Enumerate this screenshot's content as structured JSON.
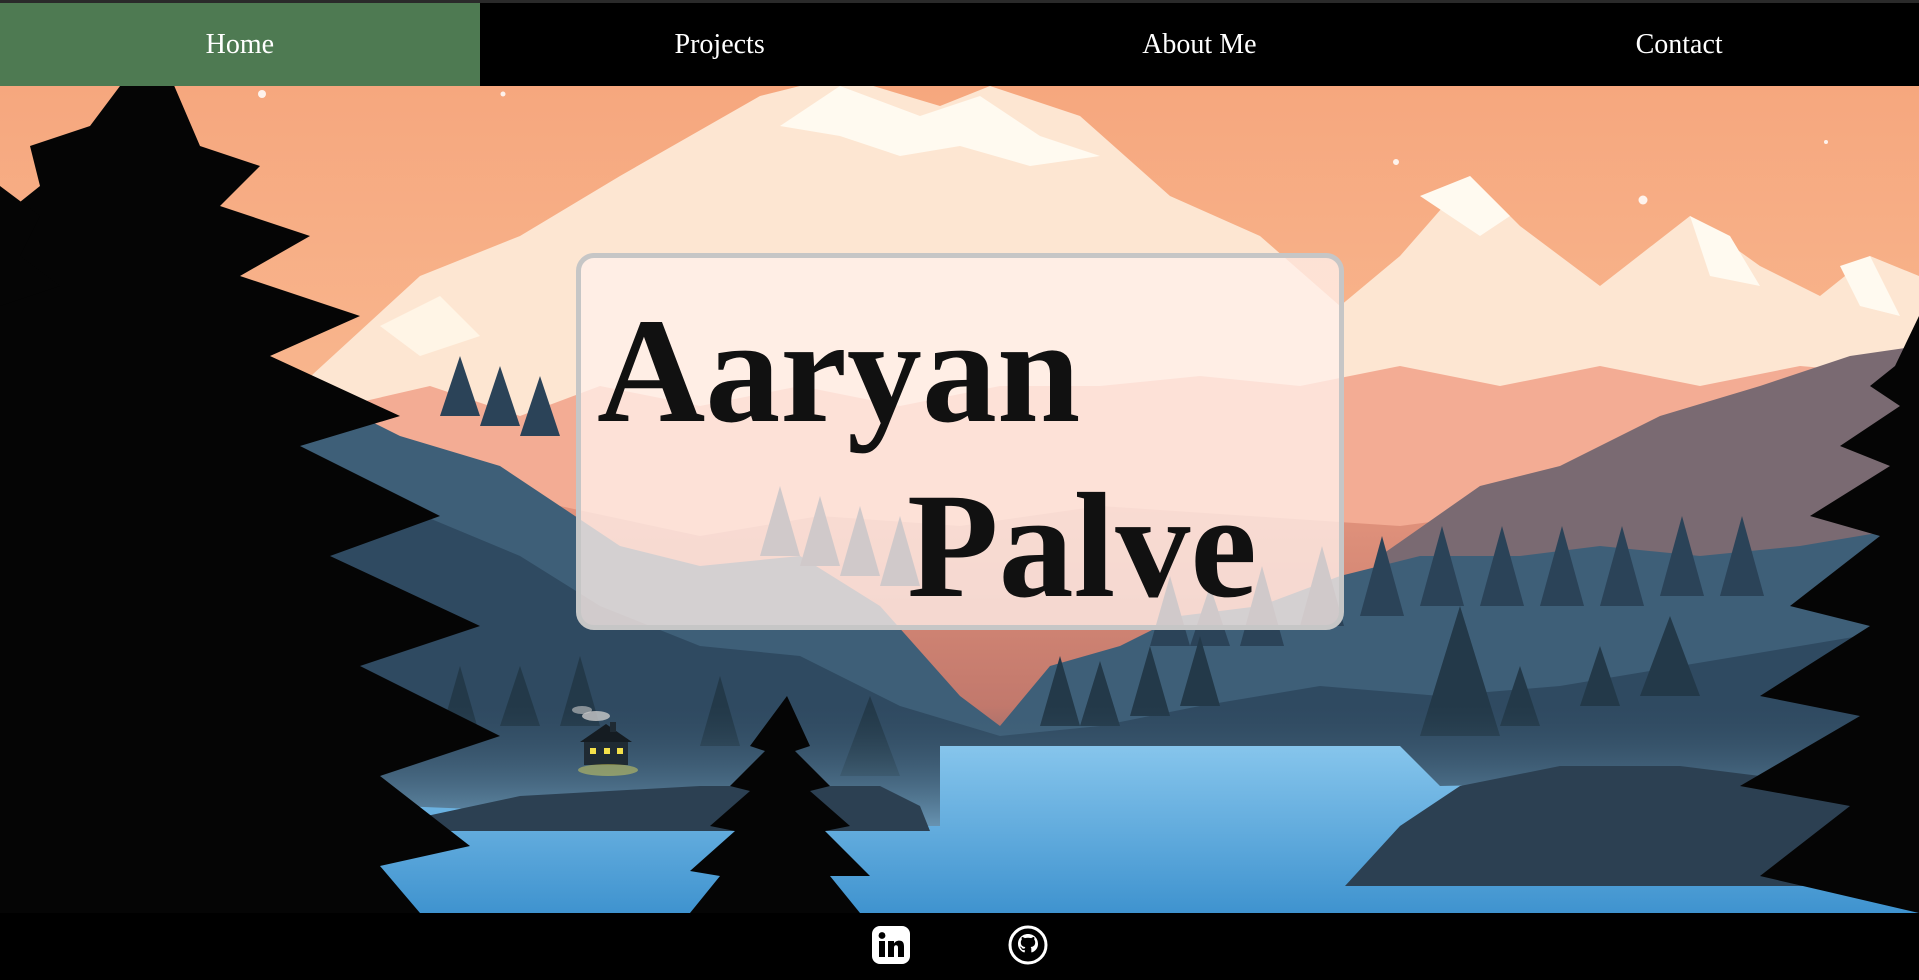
{
  "nav": {
    "items": [
      {
        "label": "Home",
        "active": true
      },
      {
        "label": "Projects",
        "active": false
      },
      {
        "label": "About Me",
        "active": false
      },
      {
        "label": "Contact",
        "active": false
      }
    ],
    "active_color": "#4e7a52"
  },
  "hero": {
    "first_name": "Aaryan",
    "last_name": "Palve"
  },
  "footer": {
    "icons": [
      {
        "name": "linkedin-icon"
      },
      {
        "name": "github-icon"
      }
    ]
  },
  "colors": {
    "sky": "#f6ad85",
    "water": "#5aa7d8",
    "forest": "#2c4257"
  }
}
